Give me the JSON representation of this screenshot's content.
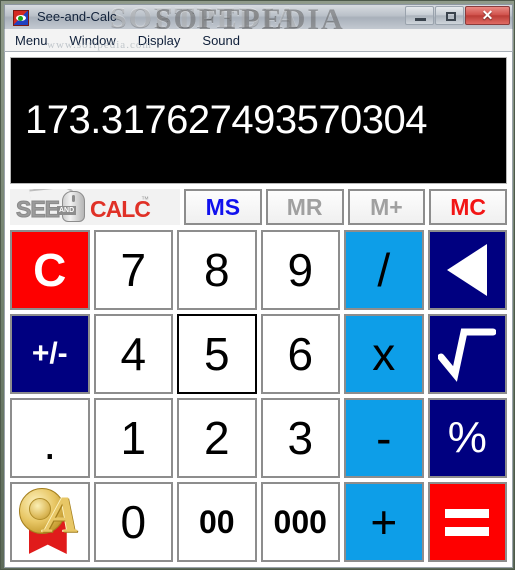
{
  "window": {
    "title": "See-and-Calc",
    "app_icon": "eye-icon",
    "watermark_light": "SOFTPEDIA",
    "watermark_dark": "SOFTPEDIA",
    "controls": {
      "minimize": "minimize-icon",
      "maximize": "maximize-icon",
      "close_label": "✕"
    }
  },
  "menubar": {
    "items": [
      {
        "label": "Menu"
      },
      {
        "label": "Window"
      },
      {
        "label": "Display"
      },
      {
        "label": "Sound"
      }
    ],
    "watermark": "www.softpedia.com"
  },
  "display": {
    "value": "173.317627493570304",
    "background": "#000000",
    "text_color": "#ffffff"
  },
  "logo": {
    "see": "SEE",
    "and": "AND",
    "calc": "CALC",
    "tm": "™",
    "see_color": "#9b9b9b",
    "calc_color": "#e03127"
  },
  "memory_buttons": [
    {
      "label": "MS",
      "color": "#1111ee",
      "state": "active"
    },
    {
      "label": "MR",
      "color": "#a0a0a0",
      "state": "disabled"
    },
    {
      "label": "M+",
      "color": "#a0a0a0",
      "state": "disabled"
    },
    {
      "label": "MC",
      "color": "#f21515",
      "state": "active"
    }
  ],
  "keypad": {
    "rows": [
      [
        {
          "label": "C",
          "name": "clear",
          "style": "red"
        },
        {
          "label": "7",
          "name": "digit-7",
          "style": "num"
        },
        {
          "label": "8",
          "name": "digit-8",
          "style": "num"
        },
        {
          "label": "9",
          "name": "digit-9",
          "style": "num"
        },
        {
          "label": "/",
          "name": "divide",
          "style": "blue"
        },
        {
          "label": "",
          "name": "backspace",
          "style": "navy",
          "icon": "backspace-triangle-icon"
        }
      ],
      [
        {
          "label": "+/-",
          "name": "sign-toggle",
          "style": "navy"
        },
        {
          "label": "4",
          "name": "digit-4",
          "style": "num"
        },
        {
          "label": "5",
          "name": "digit-5",
          "style": "num",
          "focused": true
        },
        {
          "label": "6",
          "name": "digit-6",
          "style": "num"
        },
        {
          "label": "x",
          "name": "multiply",
          "style": "blue"
        },
        {
          "label": "",
          "name": "square-root",
          "style": "navy",
          "icon": "sqrt-icon"
        }
      ],
      [
        {
          "label": ".",
          "name": "decimal-point",
          "style": "dot"
        },
        {
          "label": "1",
          "name": "digit-1",
          "style": "num"
        },
        {
          "label": "2",
          "name": "digit-2",
          "style": "num"
        },
        {
          "label": "3",
          "name": "digit-3",
          "style": "num"
        },
        {
          "label": "-",
          "name": "subtract",
          "style": "blue"
        },
        {
          "label": "%",
          "name": "percent",
          "style": "navy"
        }
      ],
      [
        {
          "label": "",
          "name": "award-badge",
          "style": "award",
          "icon": "award-medal-icon"
        },
        {
          "label": "0",
          "name": "digit-0",
          "style": "num"
        },
        {
          "label": "00",
          "name": "double-zero",
          "style": "small"
        },
        {
          "label": "000",
          "name": "triple-zero",
          "style": "small"
        },
        {
          "label": "+",
          "name": "add",
          "style": "blue"
        },
        {
          "label": "",
          "name": "equals",
          "style": "red",
          "icon": "equals-bars-icon"
        }
      ]
    ]
  },
  "colors": {
    "red": "#fe0000",
    "navy": "#000080",
    "blue": "#0d9ee8",
    "button_border": "#8d8d8d",
    "white": "#ffffff"
  }
}
